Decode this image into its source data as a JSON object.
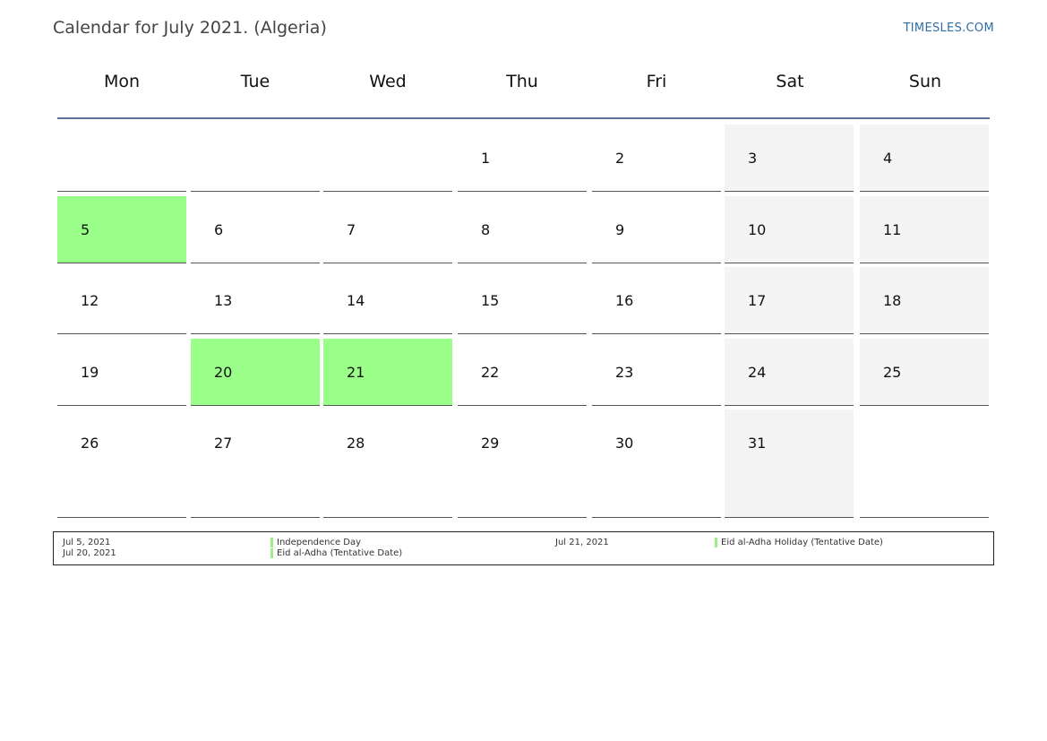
{
  "header": {
    "title": "Calendar for July 2021. (Algeria)",
    "brand": "TIMESLES.COM"
  },
  "colors": {
    "holiday": "#99ff88",
    "weekend": "#f4f4f4",
    "header_rule": "#5a7594",
    "brand": "#2f6ea6"
  },
  "weekdays": [
    "Mon",
    "Tue",
    "Wed",
    "Thu",
    "Fri",
    "Sat",
    "Sun"
  ],
  "weeks": [
    [
      {
        "day": "",
        "type": "normal"
      },
      {
        "day": "",
        "type": "normal"
      },
      {
        "day": "",
        "type": "normal"
      },
      {
        "day": "1",
        "type": "normal"
      },
      {
        "day": "2",
        "type": "normal"
      },
      {
        "day": "3",
        "type": "weekend"
      },
      {
        "day": "4",
        "type": "weekend"
      }
    ],
    [
      {
        "day": "5",
        "type": "holiday"
      },
      {
        "day": "6",
        "type": "normal"
      },
      {
        "day": "7",
        "type": "normal"
      },
      {
        "day": "8",
        "type": "normal"
      },
      {
        "day": "9",
        "type": "normal"
      },
      {
        "day": "10",
        "type": "weekend"
      },
      {
        "day": "11",
        "type": "weekend"
      }
    ],
    [
      {
        "day": "12",
        "type": "normal"
      },
      {
        "day": "13",
        "type": "normal"
      },
      {
        "day": "14",
        "type": "normal"
      },
      {
        "day": "15",
        "type": "normal"
      },
      {
        "day": "16",
        "type": "normal"
      },
      {
        "day": "17",
        "type": "weekend"
      },
      {
        "day": "18",
        "type": "weekend"
      }
    ],
    [
      {
        "day": "19",
        "type": "normal"
      },
      {
        "day": "20",
        "type": "holiday"
      },
      {
        "day": "21",
        "type": "holiday"
      },
      {
        "day": "22",
        "type": "normal"
      },
      {
        "day": "23",
        "type": "normal"
      },
      {
        "day": "24",
        "type": "weekend"
      },
      {
        "day": "25",
        "type": "weekend"
      }
    ],
    [
      {
        "day": "26",
        "type": "normal"
      },
      {
        "day": "27",
        "type": "normal"
      },
      {
        "day": "28",
        "type": "normal"
      },
      {
        "day": "29",
        "type": "normal"
      },
      {
        "day": "30",
        "type": "normal"
      },
      {
        "day": "31",
        "type": "weekend"
      },
      {
        "day": "",
        "type": "normal"
      }
    ]
  ],
  "holidays": [
    {
      "date": "Jul 5, 2021",
      "name": "Independence Day"
    },
    {
      "date": "Jul 20, 2021",
      "name": "Eid al-Adha (Tentative Date)"
    },
    {
      "date": "Jul 21, 2021",
      "name": "Eid al-Adha Holiday (Tentative Date)"
    }
  ]
}
